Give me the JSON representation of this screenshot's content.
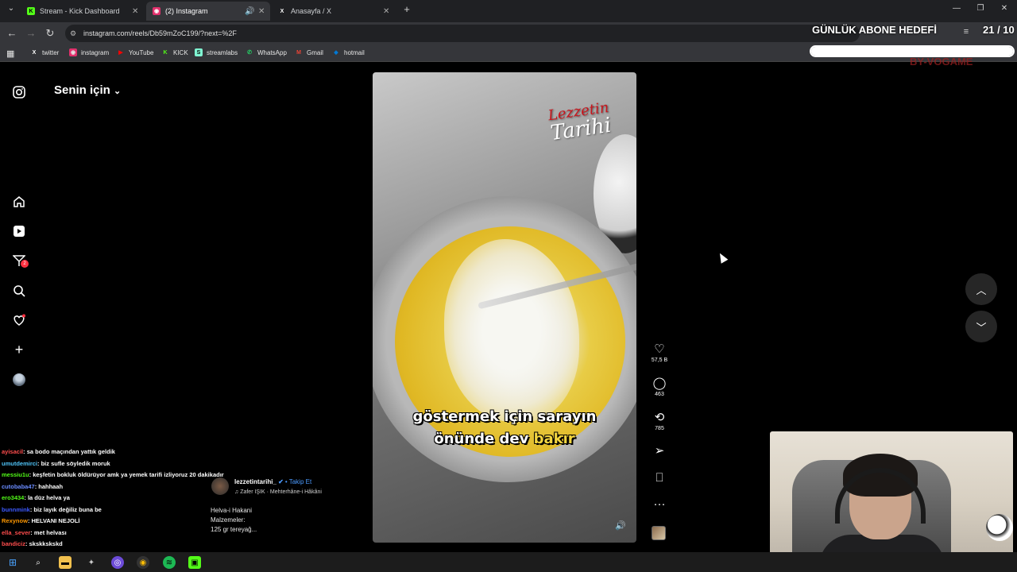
{
  "browser": {
    "tabs": [
      {
        "label": "Stream - Kick Dashboard",
        "icon": "K",
        "color": "#53fc18",
        "active": false
      },
      {
        "label": "(2) Instagram",
        "icon": "◉",
        "color": "#e1306c",
        "active": true
      },
      {
        "label": "Anasayfa / X",
        "icon": "X",
        "color": "#ffffff",
        "active": false
      }
    ],
    "url": "instagram.com/reels/Db59mZoC199/?next=%2F",
    "bookmarks": [
      {
        "label": "twitter",
        "icon": "X",
        "color": "#ffffff"
      },
      {
        "label": "instagram",
        "icon": "◉",
        "color": "#e1306c"
      },
      {
        "label": "YouTube",
        "icon": "▶",
        "color": "#ff0000"
      },
      {
        "label": "KICK",
        "icon": "K",
        "color": "#53fc18"
      },
      {
        "label": "streamlabs",
        "icon": "S",
        "color": "#80f5d2"
      },
      {
        "label": "WhatsApp",
        "icon": "✆",
        "color": "#25d366"
      },
      {
        "label": "Gmail",
        "icon": "M",
        "color": "#ea4335"
      },
      {
        "label": "hotmail",
        "icon": "◆",
        "color": "#0078d4"
      }
    ]
  },
  "overlay": {
    "goal_title": "GÜNLÜK ABONE HEDEFİ",
    "goal_count": "21 / 10",
    "goal_fraction": 1.0,
    "brand": "BY-VOGAME"
  },
  "instagram": {
    "feed_title": "Senin için",
    "notif_badge": "2",
    "reel": {
      "logo_line1": "Lezzetin",
      "logo_line2": "Tarihi",
      "subtitle_line1": "göstermek için sarayın",
      "subtitle_line2_prefix": "önünde dev ",
      "subtitle_line2_highlight": "bakır"
    },
    "actions": {
      "likes": "57,5 B",
      "comments": "463",
      "reposts": "785"
    },
    "author": {
      "username": "lezzetintarihi_",
      "follow": "• Takip Et",
      "music": "♫ Zafer IŞIK · Mehterhâne-i Hâkâni"
    },
    "caption": {
      "line1": "Helva-i Hakani",
      "line2": "Malzemeler:",
      "line3": "125 gr tereyağ..."
    }
  },
  "chat": [
    {
      "user": "ayisacil",
      "msg": ": sa bodo maçından yattık geldik",
      "color": "#ff4d4d"
    },
    {
      "user": "umutdemirci",
      "msg": ": biz sufle söyledik moruk",
      "color": "#4fc3f7"
    },
    {
      "user": "messiu1u",
      "msg": ": keşfetin bokluk öldürüyor amk ya yemek tarifi izliyoruz 20 dakikadır",
      "color": "#53fc18"
    },
    {
      "user": "cutobaba47",
      "msg": ": hahhaah",
      "color": "#6a8cff"
    },
    {
      "user": "ero3434",
      "msg": ": la düz helva ya",
      "color": "#53fc18"
    },
    {
      "user": "bunnmink",
      "msg": ": biz layık değiliz buna be",
      "color": "#3d5afe"
    },
    {
      "user": "Rexynow",
      "msg": ": HELVANI NEJOLİ",
      "color": "#ff9800"
    },
    {
      "user": "ella_sever",
      "msg": ": met helvası",
      "color": "#ff4d4d"
    },
    {
      "user": "bandiciz",
      "msg": ": skskkskskd",
      "color": "#ff4d4d"
    }
  ]
}
